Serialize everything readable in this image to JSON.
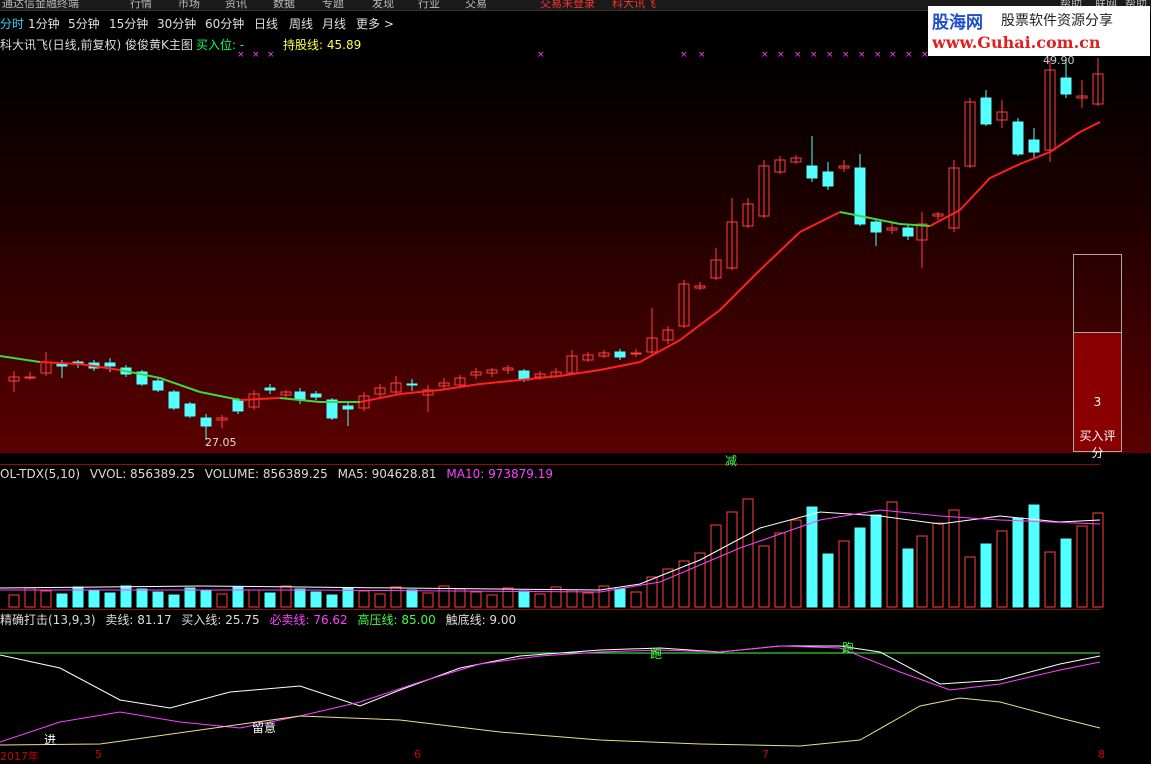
{
  "menu": {
    "items": [
      "通达信金融终端",
      "行情",
      "市场",
      "资讯",
      "数据",
      "专题",
      "发现",
      "行业",
      "交易"
    ],
    "login_status": "交易未登录",
    "formula_name": "科大讯飞",
    "right_items": [
      "帮助",
      "联网",
      "帮助"
    ]
  },
  "periods": {
    "items": [
      "分时",
      "1分钟",
      "5分钟",
      "15分钟",
      "30分钟",
      "60分钟",
      "日线",
      "周线",
      "月线",
      "更多 >"
    ],
    "active_index": 0
  },
  "title": {
    "stock": "科大讯飞(日线,前复权) 俊俊黄K主图",
    "buy_point": "买入位: -",
    "hold_line": "持股线: 45.89"
  },
  "watermark": {
    "brand": "股海网",
    "slogan": "股票软件资源分享",
    "url": "www.Guhai.com.cn"
  },
  "main_chart": {
    "high_label": "49.90",
    "low_label": "27.05",
    "signal_label": "减",
    "score_value": "3",
    "score_label": "买入评分",
    "score_fraction": 0.6
  },
  "vol_panel": {
    "name": "OL-TDX(5,10)",
    "vvol": "VVOL: 856389.25",
    "volume": "VOLUME: 856389.25",
    "ma5": "MA5: 904628.81",
    "ma10": "MA10: 973879.19"
  },
  "osc_panel": {
    "name": "精确打击(13,9,3)",
    "sell": "卖线: 81.17",
    "buy": "买入线: 25.75",
    "must_sell": "必卖线: 76.62",
    "pressure": "高压线: 85.00",
    "bottom": "触底线: 9.00",
    "labels": {
      "enter": "进",
      "notice": "留意",
      "run1": "跑",
      "run2": "跑"
    }
  },
  "dates": [
    "2017年",
    "5",
    "6",
    "7",
    "8"
  ],
  "colors": {
    "up": "#ff4040",
    "down": "#54ffff",
    "ma_red": "#ff2020",
    "ma_green": "#3fd83f",
    "pink": "#ff40ff"
  }
}
